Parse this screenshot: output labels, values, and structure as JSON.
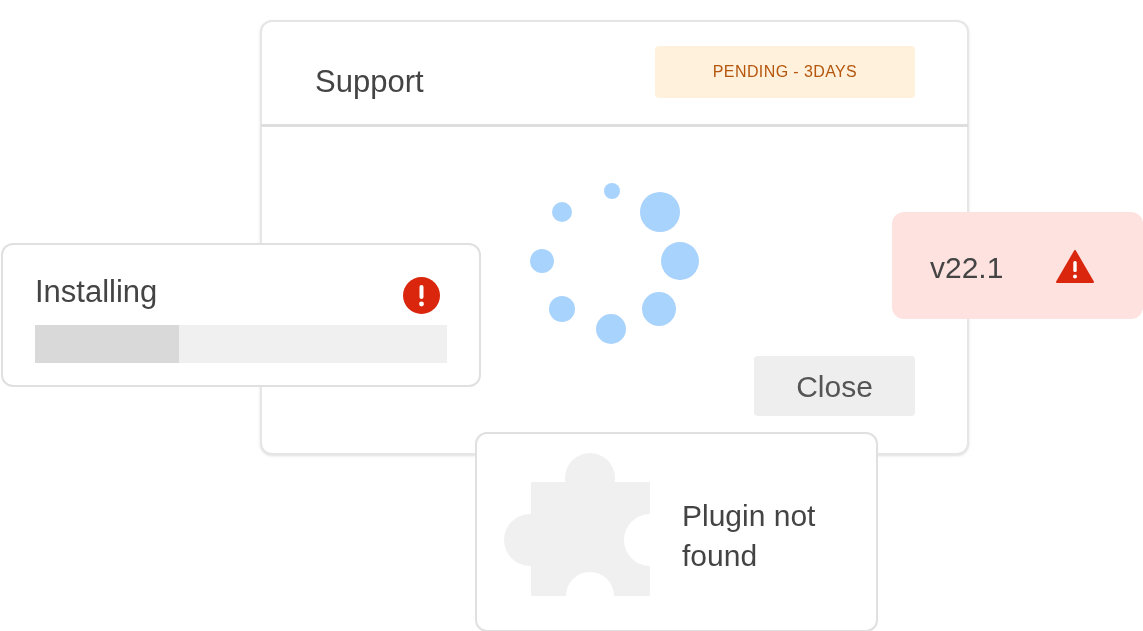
{
  "support_card": {
    "title": "Support",
    "badge": "PENDING - 3DAYS",
    "close_button": "Close"
  },
  "install_card": {
    "title": "Installing",
    "level": 0.35
  },
  "version_card": {
    "label": "v22.1"
  },
  "plugin_card": {
    "message": "Plugin not found"
  }
}
